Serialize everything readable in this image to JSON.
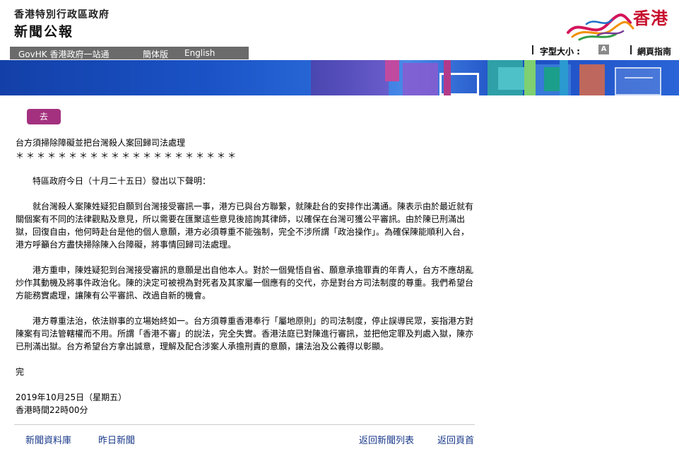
{
  "header": {
    "department": "香港特別行政區政府",
    "title": "新聞公報",
    "brand": "香港"
  },
  "nav": {
    "govhk": "GovHK 香港政府一站通",
    "simplified": "簡体版",
    "english": "English"
  },
  "tools": {
    "font_size_label": "字型大小 :",
    "font_size_button": "A",
    "sitemap": "網頁指南"
  },
  "go_button": "去",
  "article": {
    "title": "台方須掃除障礙並把台灣殺人案回歸司法處理",
    "stars": "＊＊＊＊＊＊＊＊＊＊＊＊＊＊＊＊＊＊＊＊＊",
    "lead": "特區政府今日（十月二十五日）發出以下聲明：",
    "paragraphs": [
      "就台灣殺人案陳姓疑犯自願到台灣接受審訊一事，港方已與台方聯繫，就陳赴台的安排作出溝通。陳表示由於最近就有關個案有不同的法律觀點及意見，所以需要在匯聚這些意見後諮詢其律師，以確保在台灣可獲公平審訊。由於陳已刑滿出獄，回復自由，他何時赴台是他的個人意願，港方必須尊重不能強制，完全不涉所謂「政治操作」。為確保陳能順利入台，港方呼籲台方盡快掃除陳入台障礙，將事情回歸司法處理。",
      "港方重申，陳姓疑犯到台灣接受審訊的意願是出自他本人。對於一個覺悟自省、願意承擔罪責的年青人，台方不應胡亂炒作其動機及將事件政治化。陳的決定可被視為對死者及其家屬一個應有的交代，亦是對台方司法制度的尊重。我們希望台方能務實處理，讓陳有公平審訊、改過自新的機會。",
      "港方尊重法治，依法辦事的立場始終如一。台方須尊重香港奉行「屬地原則」的司法制度，停止誤導民眾，妄指港方對陳案有司法管轄權而不用。所謂「香港不審」的說法，完全失實。香港法庭已對陳進行審訊，並把他定罪及判處入獄，陳亦已刑滿出獄。台方希望台方拿出誠意，理解及配合涉案人承擔刑責的意願，讓法治及公義得以彰顯。"
    ],
    "end": "完",
    "date": "2019年10月25日（星期五）",
    "time": "香港時間22時00分"
  },
  "footer": {
    "news_archive": "新聞資料庫",
    "yesterday": "昨日新聞",
    "back_to_list": "返回新聞列表",
    "back_to_top": "返回頁首"
  },
  "colors": {
    "accent": "#a3317f",
    "link": "#1a3a8a",
    "navbar": "#6b6b6b",
    "brand": "#c8102e"
  }
}
